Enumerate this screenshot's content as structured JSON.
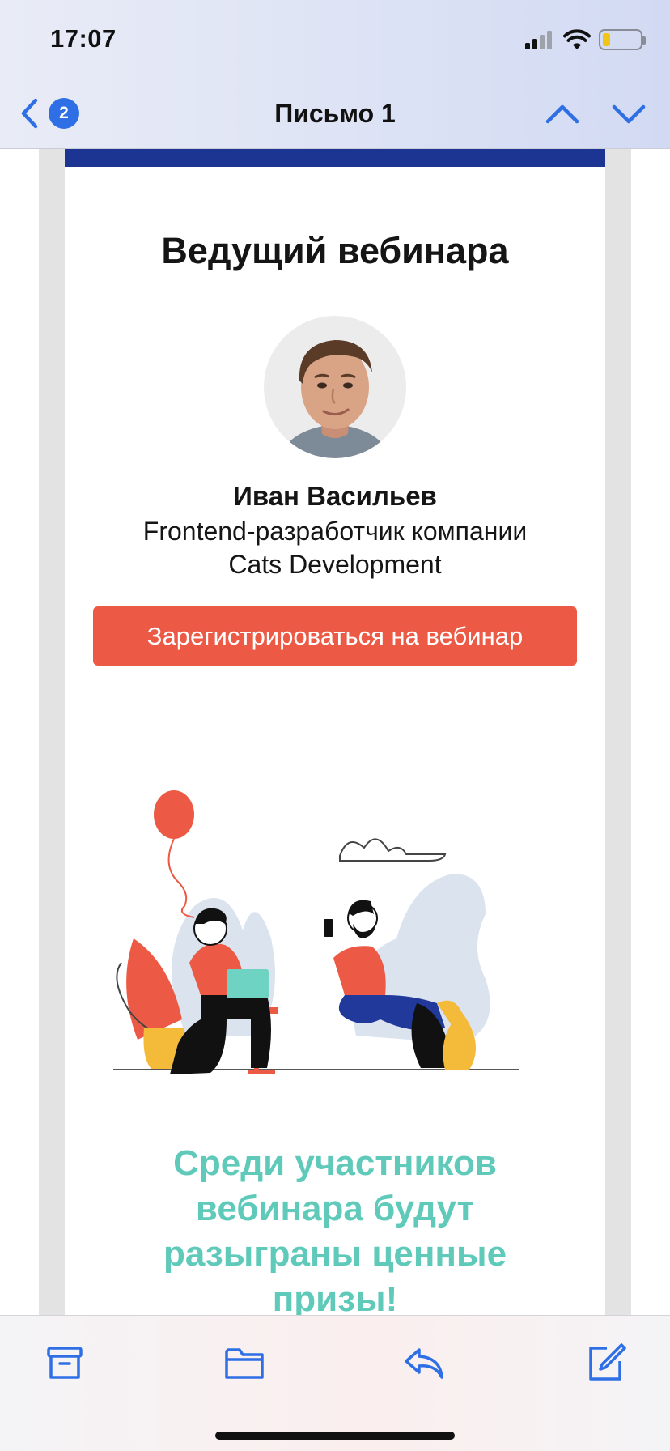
{
  "status_bar": {
    "time": "17:07",
    "icons": [
      "cellular-signal-icon",
      "wifi-icon",
      "battery-icon"
    ],
    "battery_color": "#f0c419"
  },
  "nav": {
    "back_icon": "chevron-left-icon",
    "unread_count": "2",
    "title": "Письмо 1",
    "prev_icon": "chevron-up-icon",
    "next_icon": "chevron-down-icon",
    "accent": "#2f6fe6"
  },
  "email": {
    "host_heading": "Ведущий вебинара",
    "host_avatar_icon": "host-avatar-photo",
    "host_name": "Иван Васильев",
    "host_role_line1": "Frontend-разработчик компании",
    "host_role_line2": "Cats Development",
    "register_button": "Зарегистрироваться на вебинар",
    "register_button_color": "#ec5a45",
    "illustration_icon": "webinar-people-illustration",
    "prizes_text": "Среди участников вебинара будут разыграны ценные призы!",
    "prizes_color": "#5fcab9",
    "header_bar_color": "#1c3592"
  },
  "toolbar": {
    "items": [
      {
        "name": "archive-icon"
      },
      {
        "name": "folder-icon"
      },
      {
        "name": "reply-icon"
      },
      {
        "name": "compose-icon"
      }
    ],
    "icon_color": "#2f6fe6"
  }
}
